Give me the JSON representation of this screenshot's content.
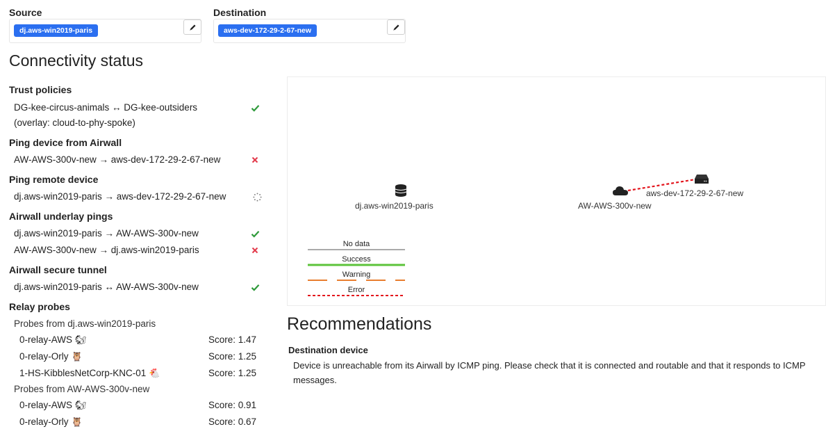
{
  "header": {
    "source_label": "Source",
    "source_value": "dj.aws-win2019-paris",
    "destination_label": "Destination",
    "destination_value": "aws-dev-172-29-2-67-new",
    "edit_icon": "pencil-icon"
  },
  "connectivity": {
    "title": "Connectivity status",
    "trust_policies": {
      "title": "Trust policies",
      "rows": [
        {
          "line1": "DG-kee-circus-animals ↔ DG-kee-outsiders",
          "line2": "(overlay: cloud-to-phy-spoke)",
          "status": "success"
        }
      ]
    },
    "ping_device": {
      "title": "Ping device from Airwall",
      "rows": [
        {
          "text": "AW-AWS-300v-new → aws-dev-172-29-2-67-new",
          "status": "error"
        }
      ]
    },
    "ping_remote": {
      "title": "Ping remote device",
      "rows": [
        {
          "text": "dj.aws-win2019-paris → aws-dev-172-29-2-67-new",
          "status": "loading"
        }
      ]
    },
    "underlay": {
      "title": "Airwall underlay pings",
      "rows": [
        {
          "text": "dj.aws-win2019-paris → AW-AWS-300v-new",
          "status": "success"
        },
        {
          "text": "AW-AWS-300v-new → dj.aws-win2019-paris",
          "status": "error"
        }
      ]
    },
    "tunnel": {
      "title": "Airwall secure tunnel",
      "rows": [
        {
          "text": "dj.aws-win2019-paris ↔ AW-AWS-300v-new",
          "status": "success"
        }
      ]
    },
    "relay": {
      "title": "Relay probes",
      "groups": [
        {
          "title": "Probes from dj.aws-win2019-paris",
          "probes": [
            {
              "name": "0-relay-AWS",
              "icon": "squirrel-icon",
              "emoji": "🐿",
              "score": "Score: 1.47"
            },
            {
              "name": "0-relay-Orly",
              "icon": "owl-icon",
              "emoji": "🦉",
              "score": "Score: 1.25"
            },
            {
              "name": "1-HS-KibblesNetCorp-KNC-01",
              "icon": "chicken-icon",
              "emoji": "🐔",
              "score": "Score: 1.25"
            }
          ]
        },
        {
          "title": "Probes from AW-AWS-300v-new",
          "probes": [
            {
              "name": "0-relay-AWS",
              "icon": "squirrel-icon",
              "emoji": "🐿",
              "score": "Score: 0.91"
            },
            {
              "name": "0-relay-Orly",
              "icon": "owl-icon",
              "emoji": "🦉",
              "score": "Score: 0.67"
            }
          ]
        }
      ]
    }
  },
  "diagram": {
    "nodes": {
      "source": {
        "label": "dj.aws-win2019-paris",
        "icon": "database-icon"
      },
      "airwall": {
        "label": "AW-AWS-300v-new",
        "icon": "cloud-icon"
      },
      "destination": {
        "label": "aws-dev-172-29-2-67-new",
        "icon": "router-icon"
      }
    },
    "links": [
      {
        "from": "source",
        "to": "airwall",
        "state": "success"
      },
      {
        "from": "airwall",
        "to": "destination",
        "state": "error"
      }
    ],
    "legend": {
      "no_data": "No data",
      "success": "Success",
      "warning": "Warning",
      "error": "Error"
    },
    "colors": {
      "success": "#5cc33a",
      "warning": "#e87d2e",
      "error": "#e3141c",
      "no_data": "#555555"
    }
  },
  "recommendations": {
    "title": "Recommendations",
    "subtitle": "Destination device",
    "text": "Device is unreachable from its Airwall by ICMP ping. Please check that it is connected and routable and that it responds to ICMP messages."
  },
  "status_colors": {
    "success": "#2e9a3a",
    "error": "#e33b4c",
    "loading": "#777777"
  }
}
